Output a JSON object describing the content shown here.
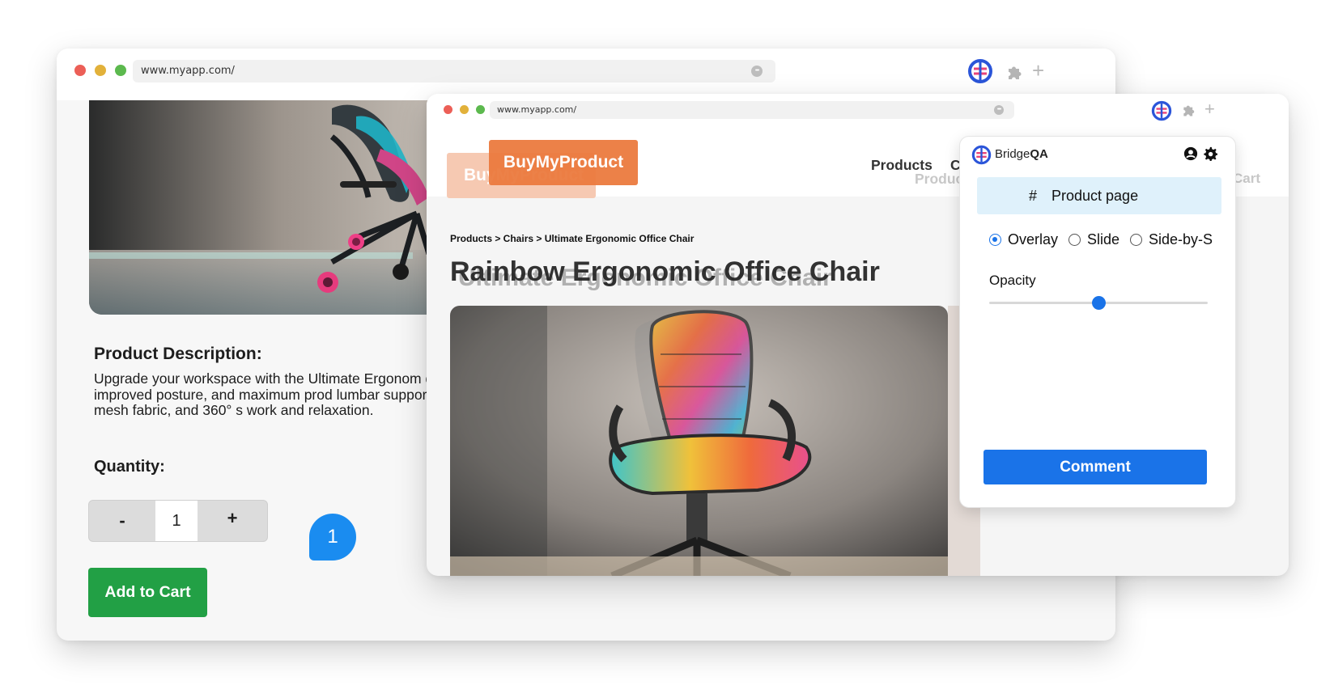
{
  "back_window": {
    "url": "www.myapp.com/",
    "description_title": "Product Description:",
    "description_text": "Upgrade your workspace with the Ultimate Ergonom day comfort, improved posture, and maximum prod lumbar support, breathable mesh fabric, and 360° s work and relaxation.",
    "quantity_label": "Quantity:",
    "qty_minus": "-",
    "qty_value": "1",
    "qty_plus": "+",
    "add_to_cart": "Add to Cart",
    "comment_badge": "1"
  },
  "front_window": {
    "url": "www.myapp.com/",
    "logo": "BuyMyProduct",
    "logo_ghost": "BuyMyProduct",
    "nav_products": "Products",
    "nav_partial": "C",
    "nav_ghost_products": "Produc",
    "nav_ghost_cart": "Cart",
    "breadcrumb": "Products > Chairs > Ultimate Ergonomic Office Chair",
    "title": "Rainbow Ergonomic Office Chair",
    "title_ghost": "Ultimate Ergonomic Office Chair"
  },
  "panel": {
    "brand_prefix": "Bridge",
    "brand_suffix": "QA",
    "page_chip_icon": "#",
    "page_chip_label": "Product page",
    "modes": [
      {
        "label": "Overlay",
        "selected": true
      },
      {
        "label": "Slide",
        "selected": false
      },
      {
        "label": "Side-by-S",
        "selected": false
      }
    ],
    "opacity_label": "Opacity",
    "opacity_value": 0.5,
    "comment_button": "Comment"
  },
  "colors": {
    "accent_blue": "#1a73e8",
    "badge_blue": "#1a8cf0",
    "cart_green": "#22a045",
    "logo_orange": "#ec7b3f",
    "chip_bg": "#dff1fb"
  },
  "icons": [
    "bridgeqa-logo-icon",
    "puzzle-extension-icon",
    "plus-icon",
    "more-options-icon",
    "user-circle-icon",
    "gear-icon"
  ]
}
